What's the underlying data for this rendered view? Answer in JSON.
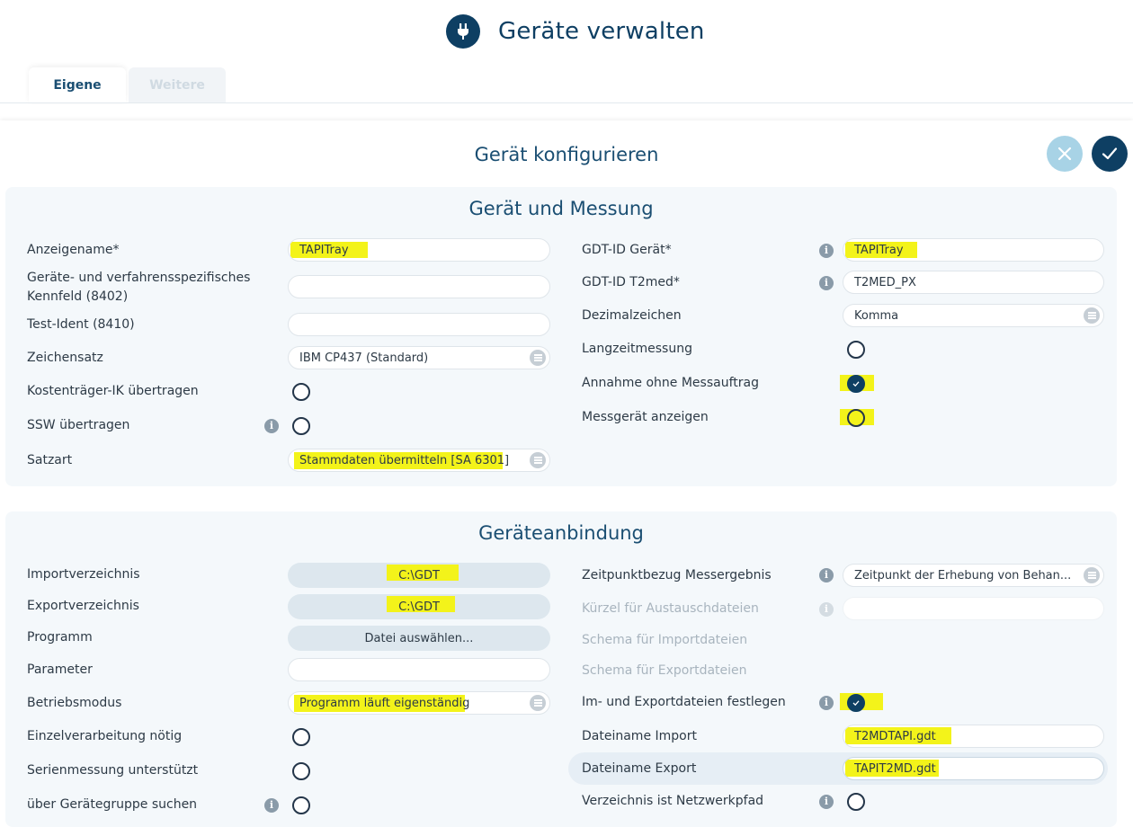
{
  "header": {
    "title": "Geräte verwalten",
    "icon": "plug-icon"
  },
  "tabs": [
    {
      "label": "Eigene",
      "active": true
    },
    {
      "label": "Weitere",
      "active": false
    }
  ],
  "config": {
    "title": "Gerät konfigurieren",
    "cancel_icon": "close-icon",
    "confirm_icon": "check-icon"
  },
  "section1": {
    "title": "Gerät und Messung",
    "left": {
      "anzeigename": {
        "label": "Anzeigename*",
        "value": "TAPITray"
      },
      "kennfeld": {
        "label_line1": "Geräte- und verfahrensspezifisches",
        "label_line2": "Kennfeld (8402)",
        "value": ""
      },
      "testident": {
        "label": "Test-Ident (8410)",
        "value": ""
      },
      "zeichensatz": {
        "label": "Zeichensatz",
        "value": "IBM CP437 (Standard)"
      },
      "kostentraeger": {
        "label": "Kostenträger-IK übertragen",
        "checked": false
      },
      "ssw": {
        "label": "SSW übertragen",
        "checked": false
      },
      "satzart": {
        "label": "Satzart",
        "value": "Stammdaten übermitteln [SA 6301]"
      }
    },
    "right": {
      "gdt_geraet": {
        "label": "GDT-ID Gerät*",
        "value": "TAPITray"
      },
      "gdt_t2med": {
        "label": "GDT-ID T2med*",
        "value": "T2MED_PX"
      },
      "dezimal": {
        "label": "Dezimalzeichen",
        "value": "Komma"
      },
      "langzeit": {
        "label": "Langzeitmessung",
        "checked": false
      },
      "annahme": {
        "label": "Annahme ohne Messauftrag",
        "checked": true
      },
      "messgeraet": {
        "label": "Messgerät anzeigen",
        "checked": false
      }
    }
  },
  "section2": {
    "title": "Geräteanbindung",
    "left": {
      "import": {
        "label": "Importverzeichnis",
        "value": "C:\\GDT"
      },
      "export": {
        "label": "Exportverzeichnis",
        "value": "C:\\GDT"
      },
      "programm": {
        "label": "Programm",
        "value": "Datei auswählen..."
      },
      "parameter": {
        "label": "Parameter",
        "value": ""
      },
      "betrieb": {
        "label": "Betriebsmodus",
        "value": "Programm läuft eigenständig"
      },
      "einzel": {
        "label": "Einzelverarbeitung nötig",
        "checked": false
      },
      "serie": {
        "label": "Serienmessung unterstützt",
        "checked": false
      },
      "gruppe": {
        "label": "über Gerätegruppe suchen",
        "checked": false
      }
    },
    "right": {
      "zeitpunkt": {
        "label": "Zeitpunktbezug Messergebnis",
        "value": "Zeitpunkt der Erhebung von Behan..."
      },
      "kuerzel": {
        "label": "Kürzel für Austauschdateien",
        "value": ""
      },
      "schema_import": {
        "label": "Schema für Importdateien"
      },
      "schema_export": {
        "label": "Schema für Exportdateien"
      },
      "festlegen": {
        "label": "Im- und Exportdateien festlegen",
        "checked": true
      },
      "dn_import": {
        "label": "Dateiname Import",
        "value": "T2MDTAPI.gdt"
      },
      "dn_export": {
        "label": "Dateiname Export",
        "value": "TAPIT2MD.gdt"
      },
      "netzwerk": {
        "label": "Verzeichnis ist Netzwerkpfad",
        "checked": false
      }
    }
  },
  "info_glyph": "i",
  "colors": {
    "primary": "#0e3f63",
    "highlight": "#f3f31a",
    "section_bg": "#f4f8fb",
    "cancel": "#a8d3e6"
  }
}
